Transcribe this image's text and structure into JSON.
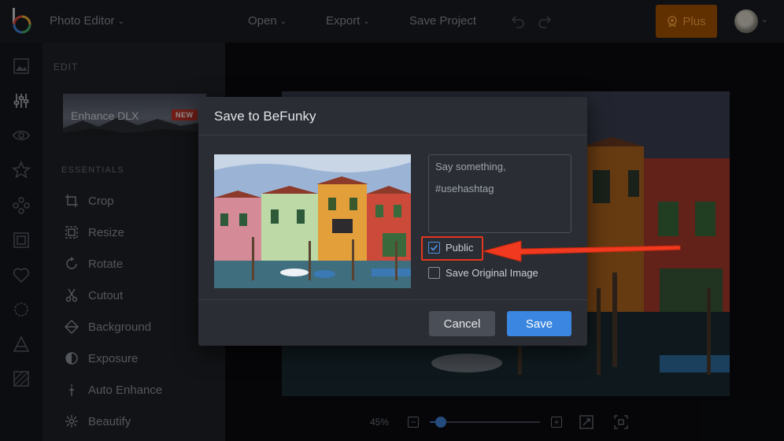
{
  "topbar": {
    "app_menu": "Photo Editor",
    "open": "Open",
    "export": "Export",
    "save_project": "Save Project",
    "plus": "Plus"
  },
  "rail_icons": [
    "image-icon",
    "sliders-icon",
    "eye-icon",
    "star-icon",
    "nodes-icon",
    "frame-icon",
    "heart-icon",
    "badge-icon",
    "triangle-icon",
    "texture-icon"
  ],
  "panel": {
    "title": "EDIT",
    "enhance_card": {
      "label": "Enhance DLX",
      "badge": "NEW"
    },
    "section": "ESSENTIALS",
    "tools": [
      {
        "label": "Crop",
        "icon": "crop-icon"
      },
      {
        "label": "Resize",
        "icon": "resize-icon"
      },
      {
        "label": "Rotate",
        "icon": "rotate-icon"
      },
      {
        "label": "Cutout",
        "icon": "scissors-icon"
      },
      {
        "label": "Background",
        "icon": "background-icon"
      },
      {
        "label": "Exposure",
        "icon": "exposure-icon"
      },
      {
        "label": "Auto Enhance",
        "icon": "wand-icon"
      },
      {
        "label": "Beautify",
        "icon": "beautify-icon"
      }
    ]
  },
  "zoom": {
    "label": "45%",
    "level": 0.1
  },
  "dialog": {
    "title": "Save to BeFunky",
    "caption_line1": "Say something,",
    "caption_line2": "#usehashtag",
    "public_label": "Public",
    "public_checked": true,
    "original_label": "Save Original Image",
    "original_checked": false,
    "cancel": "Cancel",
    "save": "Save"
  },
  "colors": {
    "accent": "#3a86e0",
    "plus_bg": "#a55300",
    "plus_text": "#ffa542",
    "highlight": "#e3361f"
  }
}
